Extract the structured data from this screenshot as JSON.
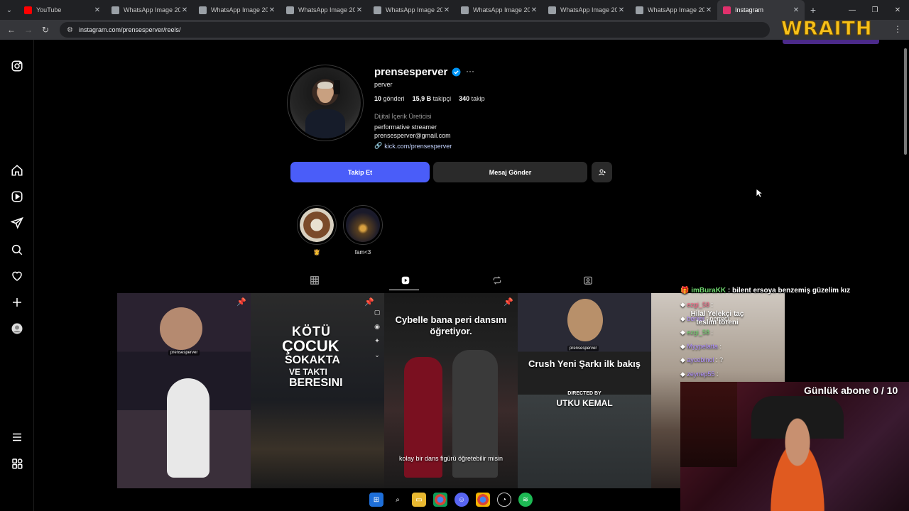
{
  "browser": {
    "tabs": [
      {
        "title": "YouTube",
        "icon": "youtube-icon",
        "color": "#ff0000"
      },
      {
        "title": "WhatsApp Image 202",
        "icon": "globe-icon",
        "color": "#9aa0a6"
      },
      {
        "title": "WhatsApp Image 202",
        "icon": "globe-icon",
        "color": "#9aa0a6"
      },
      {
        "title": "WhatsApp Image 202",
        "icon": "globe-icon",
        "color": "#9aa0a6"
      },
      {
        "title": "WhatsApp Image 202",
        "icon": "globe-icon",
        "color": "#9aa0a6"
      },
      {
        "title": "WhatsApp Image 202",
        "icon": "globe-icon",
        "color": "#9aa0a6"
      },
      {
        "title": "WhatsApp Image 202",
        "icon": "globe-icon",
        "color": "#9aa0a6"
      },
      {
        "title": "WhatsApp Image 202",
        "icon": "globe-icon",
        "color": "#9aa0a6"
      },
      {
        "title": "Instagram",
        "icon": "instagram-icon",
        "color": "#e1306c",
        "active": true
      }
    ],
    "url": "instagram.com/prensesperver/reels/",
    "overlay_brand": "WRAITH"
  },
  "profile": {
    "username": "prensesperver",
    "full_name": "perver",
    "stats": {
      "posts_value": "10",
      "posts_label": "gönderi",
      "followers_value": "15,9 B",
      "followers_label": "takipçi",
      "following_value": "340",
      "following_label": "takip"
    },
    "category": "Dijital İçerik Üreticisi",
    "bio_line1": "performative streamer",
    "bio_line2": "prensesperver@gmail.com",
    "link": "kick.com/prensesperver",
    "follow_label": "Takip Et",
    "message_label": "Mesaj Gönder",
    "accent": "#4a5df9"
  },
  "highlights": [
    {
      "label": "👸",
      "icon": "food-thumb"
    },
    {
      "label": "fam<3",
      "icon": "night-thumb"
    }
  ],
  "reels": [
    {
      "streamer": "prensesperver",
      "pinned": true
    },
    {
      "lines": [
        "KÖTÜ",
        "ÇOCUK",
        "SOKAKTA",
        "VE TAKTI",
        "BERESINI"
      ],
      "pinned": true
    },
    {
      "caption_top": "Cybelle bana peri dansını öğretiyor.",
      "caption_bottom": "kolay bir dans figürü öğretebilir misin",
      "pinned": true
    },
    {
      "streamer": "prensesperver",
      "title": "Crush Yeni Şarkı ilk bakış",
      "directed_by": "DIRECTED BY",
      "director": "UTKU KEMAL"
    },
    {}
  ],
  "stream": {
    "chat_user": "imBuraKK",
    "chat_message": ": bilent ersoya benzemiş güzelim kız",
    "chat_lines": [
      {
        "user": "ezgi_58",
        "text": ":"
      },
      {
        "user": "berkel",
        "text": ": perfect"
      },
      {
        "user": "ezgi_58",
        "text": ":"
      },
      {
        "user": "Myypelatta",
        "text": ":"
      },
      {
        "user": "aycebinol",
        "text": ": ?"
      },
      {
        "user": "zeynep55",
        "text": ":"
      }
    ],
    "overlay_caption": "Hilal Yelekçi taç teslim töreni",
    "goal_text": "Günlük abone 0 / 10"
  }
}
